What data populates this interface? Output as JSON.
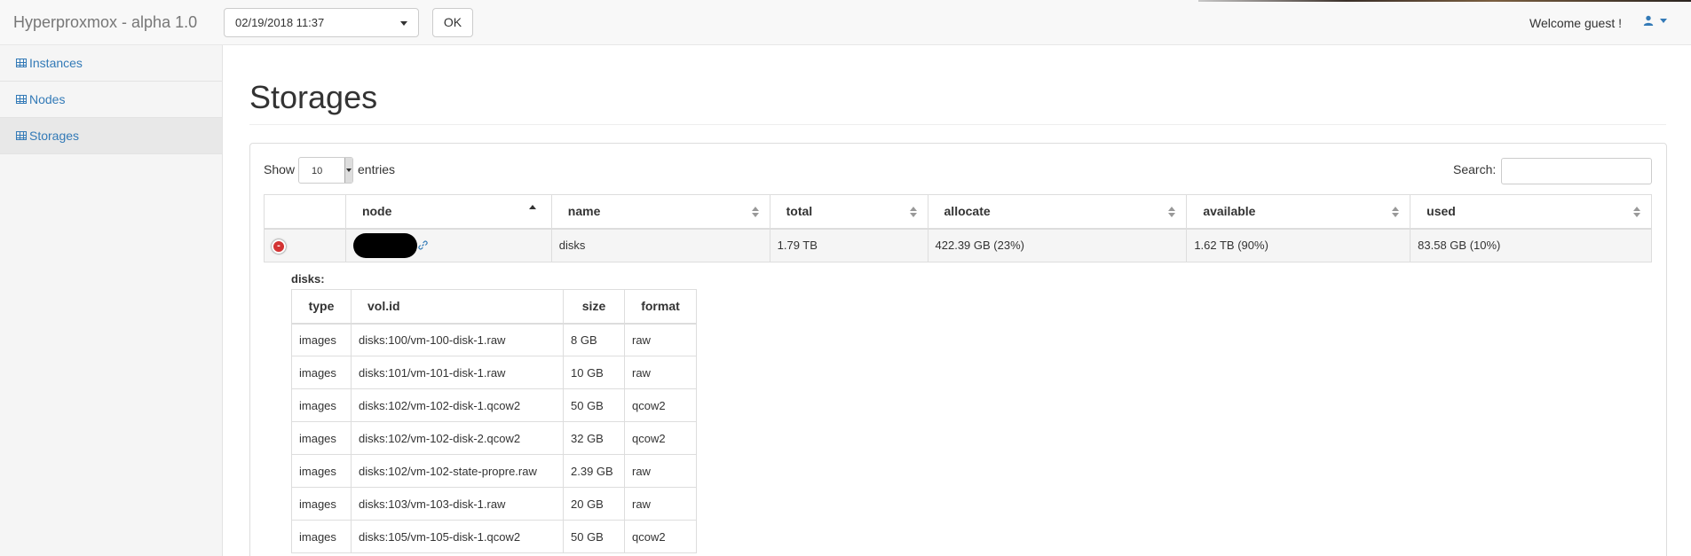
{
  "app": {
    "title": "Hyperproxmox - alpha 1.0"
  },
  "header": {
    "date_value": "02/19/2018 11:37",
    "ok_label": "OK",
    "welcome": "Welcome guest !"
  },
  "sidebar": {
    "items": [
      {
        "label": "Instances"
      },
      {
        "label": "Nodes"
      },
      {
        "label": "Storages"
      }
    ]
  },
  "page": {
    "title": "Storages"
  },
  "controls": {
    "show_label": "Show",
    "page_length": "10",
    "entries_label": "entries",
    "search_label": "Search:",
    "search_value": ""
  },
  "table": {
    "columns": [
      "node",
      "name",
      "total",
      "allocate",
      "available",
      "used"
    ],
    "rows": [
      {
        "expand": "-",
        "node": "",
        "name": "disks",
        "total": "1.79 TB",
        "allocate": "422.39 GB (23%)",
        "available": "1.62 TB (90%)",
        "used": "83.58 GB (10%)"
      }
    ]
  },
  "detail": {
    "title": "disks:",
    "columns": [
      "type",
      "vol.id",
      "size",
      "format"
    ],
    "rows": [
      {
        "type": "images",
        "volid": "disks:100/vm-100-disk-1.raw",
        "size": "8 GB",
        "format": "raw"
      },
      {
        "type": "images",
        "volid": "disks:101/vm-101-disk-1.raw",
        "size": "10 GB",
        "format": "raw"
      },
      {
        "type": "images",
        "volid": "disks:102/vm-102-disk-1.qcow2",
        "size": "50 GB",
        "format": "qcow2"
      },
      {
        "type": "images",
        "volid": "disks:102/vm-102-disk-2.qcow2",
        "size": "32 GB",
        "format": "qcow2"
      },
      {
        "type": "images",
        "volid": "disks:102/vm-102-state-propre.raw",
        "size": "2.39 GB",
        "format": "raw"
      },
      {
        "type": "images",
        "volid": "disks:103/vm-103-disk-1.raw",
        "size": "20 GB",
        "format": "raw"
      },
      {
        "type": "images",
        "volid": "disks:105/vm-105-disk-1.qcow2",
        "size": "50 GB",
        "format": "qcow2"
      }
    ]
  },
  "icons": {
    "user": "user-icon",
    "table": "table-icon",
    "link": "link-icon",
    "collapse": "minus-circle-icon"
  },
  "colors": {
    "link": "#337ab7",
    "collapse": "#d33333"
  }
}
